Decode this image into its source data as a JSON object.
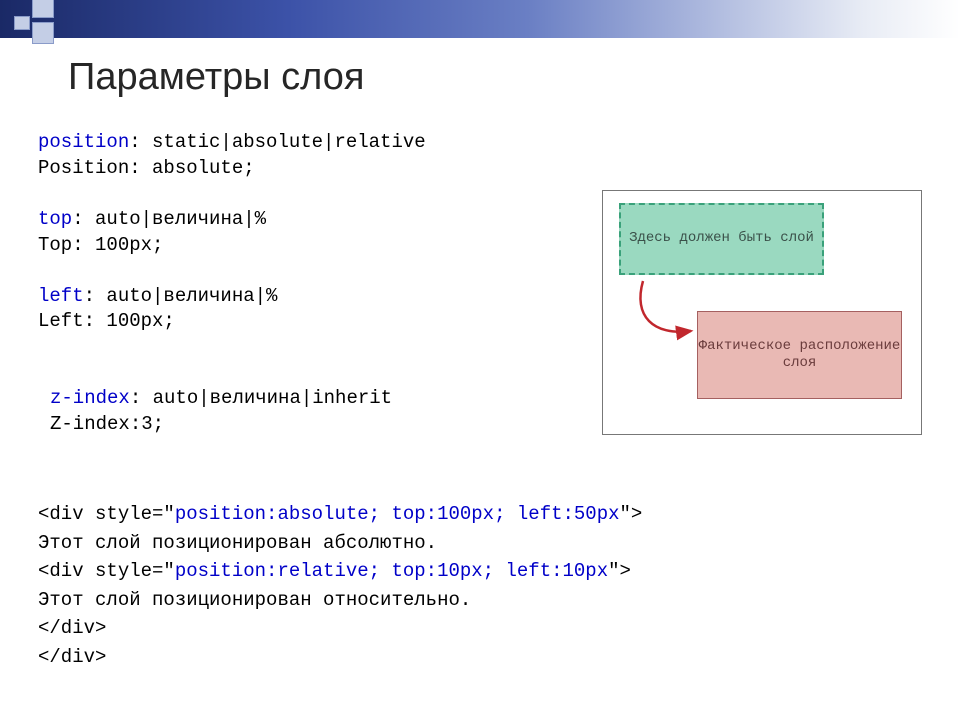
{
  "title": "Параметры слоя",
  "props": {
    "position_syntax_kw": "position",
    "position_syntax_rest": ": static|absolute|relative",
    "position_example": "Position: absolute;",
    "top_syntax_kw": "top",
    "top_syntax_rest": ": auto|величина|%",
    "top_example": "Top: 100px;",
    "left_syntax_kw": "left",
    "left_syntax_rest": ": auto|величина|%",
    "left_example": "Left: 100px;",
    "zindex_syntax_kw": "z-index",
    "zindex_syntax_rest": ": auto|величина|inherit",
    "zindex_example": "Z-index:3;"
  },
  "illustration": {
    "box1": "Здесь должен быть слой",
    "box2": "Фактическое расположение слоя"
  },
  "example": {
    "open1_a": "<div style=\"",
    "open1_b": "position:absolute; top:100px; left:50px",
    "open1_c": "\">",
    "text1": "Этот слой позиционирован абсолютно.",
    "open2_a": "<div style=\"",
    "open2_b": "position:relative; top:10px; left:10px",
    "open2_c": "\">",
    "text2": "Этот слой позиционирован относительно.",
    "close1": "</div>",
    "close2": "</div>"
  }
}
